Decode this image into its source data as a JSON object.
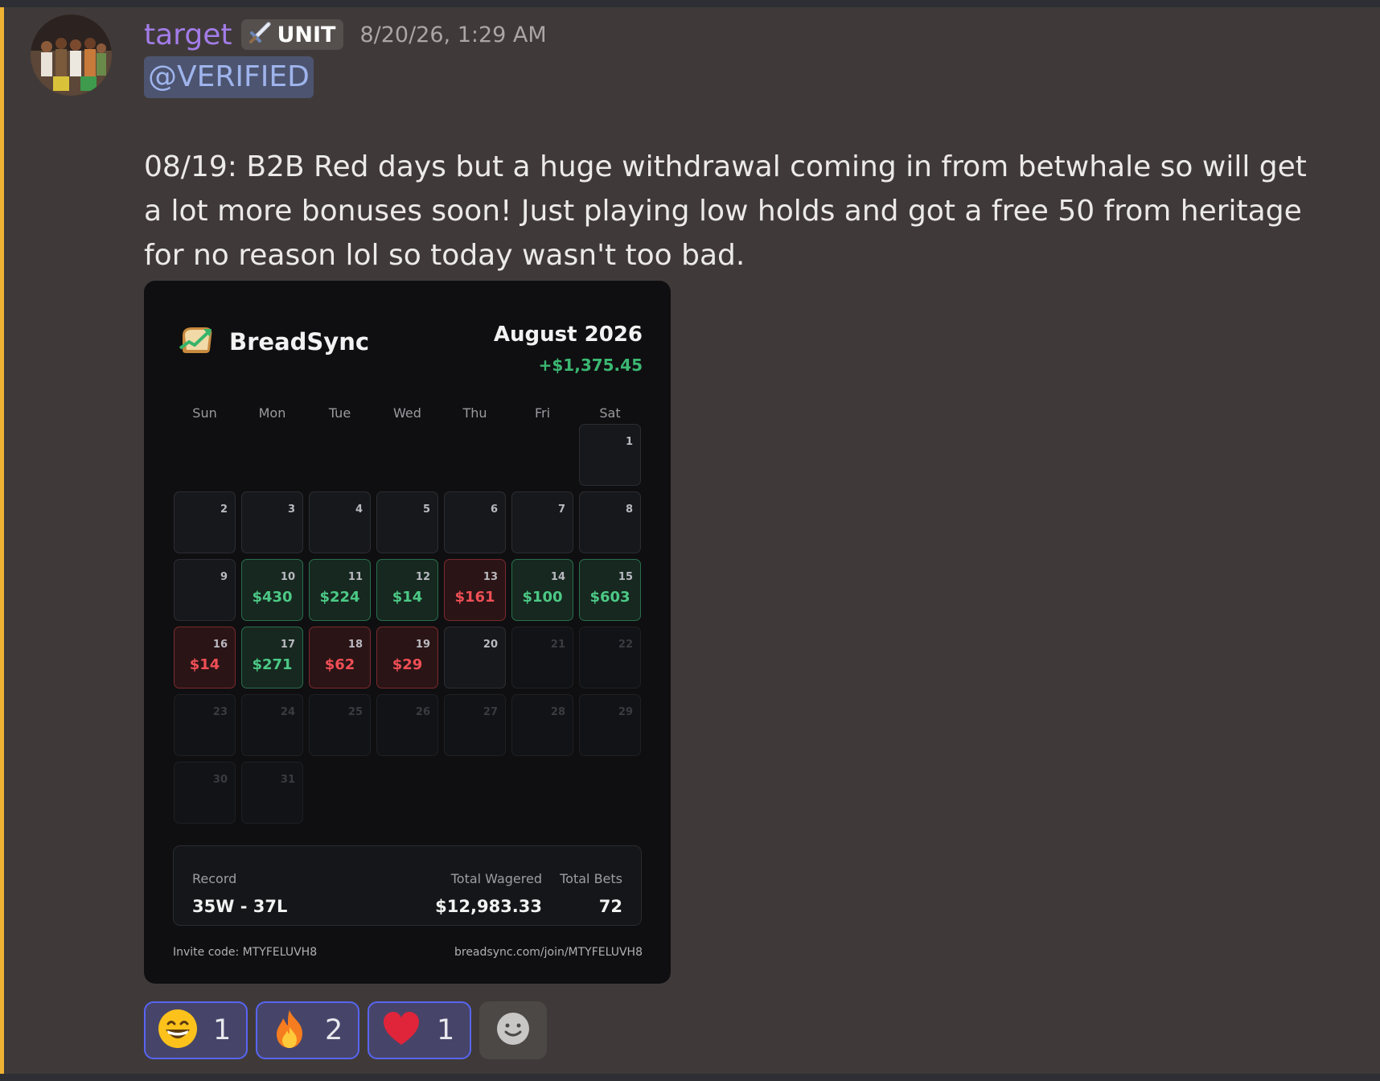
{
  "message": {
    "username": "target",
    "tag_label": "UNIT",
    "timestamp": "8/20/26, 1:29 AM",
    "mention": "@VERIFIED",
    "text": "08/19: B2B Red days but a huge withdrawal coming in from betwhale so will get a lot more bonuses soon! Just playing low holds and got a free 50 from heritage for no reason lol so today wasn't too bad."
  },
  "card": {
    "brand": "BreadSync",
    "month": "August 2026",
    "month_total": "+$1,375.45",
    "weekdays": [
      "Sun",
      "Mon",
      "Tue",
      "Wed",
      "Thu",
      "Fri",
      "Sat"
    ],
    "days": {
      "d1": "1",
      "d2": "2",
      "d3": "3",
      "d4": "4",
      "d5": "5",
      "d6": "6",
      "d7": "7",
      "d8": "8",
      "d9": "9",
      "d10": "10",
      "d11": "11",
      "d12": "12",
      "d13": "13",
      "d14": "14",
      "d15": "15",
      "d16": "16",
      "d17": "17",
      "d18": "18",
      "d19": "19",
      "d20": "20",
      "d21": "21",
      "d22": "22",
      "d23": "23",
      "d24": "24",
      "d25": "25",
      "d26": "26",
      "d27": "27",
      "d28": "28",
      "d29": "29",
      "d30": "30",
      "d31": "31"
    },
    "amounts": {
      "d10": "$430",
      "d11": "$224",
      "d12": "$14",
      "d13": "$161",
      "d14": "$100",
      "d15": "$603",
      "d16": "$14",
      "d17": "$271",
      "d18": "$62",
      "d19": "$29"
    },
    "record_label": "Record",
    "record_value": "35W - 37L",
    "wagered_label": "Total Wagered",
    "wagered_value": "$12,983.33",
    "bets_label": "Total Bets",
    "bets_value": "72",
    "invite": "Invite code: MTYFELUVH8",
    "invite_url": "breadsync.com/join/MTYFELUVH8"
  },
  "reactions": [
    {
      "icon": "grinning-face-icon",
      "count": "1"
    },
    {
      "icon": "fire-icon",
      "count": "2"
    },
    {
      "icon": "red-heart-icon",
      "count": "1"
    }
  ],
  "colors": {
    "background": "#3f3a39",
    "username": "#a37ce8",
    "win": "#4cc986",
    "loss": "#ef4f55",
    "reaction_border": "#5865f2",
    "left_accent": "#f0b232"
  }
}
